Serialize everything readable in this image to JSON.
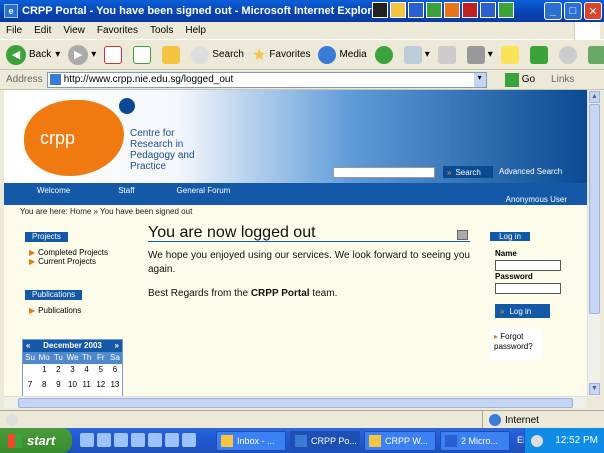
{
  "window": {
    "title": "CRPP Portal - You have been signed out - Microsoft Internet Explorer"
  },
  "menu": [
    "File",
    "Edit",
    "View",
    "Favorites",
    "Tools",
    "Help"
  ],
  "toolbar": {
    "back": "Back",
    "search": "Search",
    "favorites": "Favorites",
    "media": "Media"
  },
  "address": {
    "label": "Address",
    "url": "http://www.crpp.nie.edu.sg/logged_out",
    "go": "Go",
    "links": "Links"
  },
  "site": {
    "logo_text": "crpp",
    "centre_lines": [
      "Centre for",
      "Research in",
      "Pedagogy and",
      "Practice"
    ],
    "search_button": "Search",
    "advanced_search": "Advanced Search",
    "nav": [
      "Welcome",
      "Staff",
      "General Forum"
    ],
    "anon": "Anonymous User",
    "breadcrumb": "You are here: Home » You have been signed out"
  },
  "sidebar": {
    "projects_header": "Projects",
    "projects": [
      "Completed Projects",
      "Current Projects"
    ],
    "pubs_header": "Publications",
    "pubs": [
      "Publications"
    ]
  },
  "calendar": {
    "title": "December 2003",
    "days": [
      "Su",
      "Mo",
      "Tu",
      "We",
      "Th",
      "Fr",
      "Sa"
    ],
    "rows": [
      [
        "",
        "1",
        "2",
        "3",
        "4",
        "5",
        "6"
      ],
      [
        "7",
        "8",
        "9",
        "10",
        "11",
        "12",
        "13"
      ]
    ]
  },
  "main": {
    "title": "You are now logged out",
    "body": "We hope you enjoyed using our services. We look forward to seeing you again.",
    "regards_pre": "Best Regards from the ",
    "regards_bold": "CRPP Portal",
    "regards_post": " team."
  },
  "login": {
    "header": "Log in",
    "name_label": "Name",
    "password_label": "Password",
    "button": "Log in",
    "forgot": "Forgot password?"
  },
  "status": {
    "zone": "Internet"
  },
  "taskbar": {
    "start": "start",
    "tasks": [
      "Inbox - ...",
      "CRPP Po...",
      "CRPP W...",
      "2 Micro..."
    ],
    "lang": "EN",
    "clock": "12:52 PM"
  }
}
